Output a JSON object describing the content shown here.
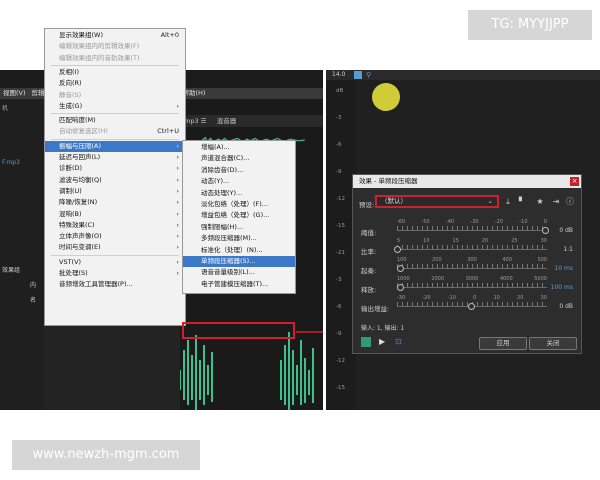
{
  "watermarks": {
    "top": "TG: MYYJJPP",
    "bottom": "www.newzh-mgm.com"
  },
  "menubar": [
    "视图(V)",
    "剪辑(C)",
    "效果(S)",
    "收藏夹(R)",
    "视图(V)",
    "窗口(W)",
    "帮助(H)"
  ],
  "menubar_active_index": 2,
  "left_fragments": {
    "left_top_label": "机",
    "file_label": "F.mp3",
    "effects_label": "效果组",
    "inner_label": "内",
    "default_label": "名"
  },
  "editor_tabs": [
    "mp3 ☰",
    "混音器"
  ],
  "effects_menu": [
    {
      "label": "显示效果组(W)",
      "accel": "Alt+0",
      "disabled": false
    },
    {
      "label": "编辑效果组内的剪辑效果(F)",
      "accel": "",
      "disabled": true
    },
    {
      "label": "编辑效果组内的音轨效果(T)",
      "accel": "",
      "disabled": true
    },
    {
      "label": "反相(I)",
      "accel": "",
      "disabled": false
    },
    {
      "label": "反向(R)",
      "accel": "",
      "disabled": false
    },
    {
      "label": "静音(S)",
      "accel": "",
      "disabled": true
    },
    {
      "label": "生成(G)",
      "accel": "›",
      "disabled": false
    },
    {
      "label": "匹配响度(M)",
      "accel": "",
      "disabled": false
    },
    {
      "label": "自动修复选区(H)",
      "accel": "Ctrl+U",
      "disabled": true
    },
    {
      "label": "振幅与压限(A)",
      "accel": "›",
      "disabled": false,
      "highlight": true
    },
    {
      "label": "延迟与回声(L)",
      "accel": "›",
      "disabled": false
    },
    {
      "label": "诊断(D)",
      "accel": "›",
      "disabled": false
    },
    {
      "label": "滤波与均衡(Q)",
      "accel": "›",
      "disabled": false
    },
    {
      "label": "调制(U)",
      "accel": "›",
      "disabled": false
    },
    {
      "label": "降噪/恢复(N)",
      "accel": "›",
      "disabled": false
    },
    {
      "label": "混响(B)",
      "accel": "›",
      "disabled": false
    },
    {
      "label": "特殊效果(C)",
      "accel": "›",
      "disabled": false
    },
    {
      "label": "立体声声像(O)",
      "accel": "›",
      "disabled": false
    },
    {
      "label": "时间与变调(E)",
      "accel": "›",
      "disabled": false
    },
    {
      "label": "VST(V)",
      "accel": "›",
      "disabled": false
    },
    {
      "label": "批处理(S)",
      "accel": "›",
      "disabled": false
    },
    {
      "label": "音频增效工具管理器(P)...",
      "accel": "",
      "disabled": false
    }
  ],
  "submenu": [
    {
      "label": "增幅(A)..."
    },
    {
      "label": "声道混合器(C)..."
    },
    {
      "label": "消除齿音(D)..."
    },
    {
      "label": "动态(Y)..."
    },
    {
      "label": "动态处理(Y)..."
    },
    {
      "label": "淡化包络（处理）(F)..."
    },
    {
      "label": "增益包络（处理）(G)..."
    },
    {
      "label": "强制限幅(H)..."
    },
    {
      "label": "多频段压缩器(M)..."
    },
    {
      "label": "标准化（处理）(N)..."
    },
    {
      "label": "单频段压缩器(S)...",
      "highlight": true
    },
    {
      "label": "语音音量级别(L)..."
    },
    {
      "label": "电子管建模压缩器(T)..."
    }
  ],
  "right_panel": {
    "zoom": "14.0",
    "db_label": "dB",
    "db_scale": [
      "dB",
      "-3",
      "-6",
      "-9",
      "-12",
      "-15",
      "-21",
      "-3",
      "-6",
      "-9",
      "-12",
      "-15"
    ]
  },
  "dialog": {
    "title": "效果 - 单频段压缩器",
    "preset_label": "预设:",
    "preset_value": "（默认）",
    "icons": [
      "download-icon",
      "delete-icon",
      "favorite-icon",
      "apply-icon",
      "info-icon"
    ],
    "rows": [
      {
        "label": "阈值:",
        "ticks": [
          "-60",
          "-50",
          "-40",
          "-30",
          "-20",
          "-10",
          "0"
        ],
        "value": "0 dB",
        "value_color": "#cfcfcf",
        "level": 1.0
      },
      {
        "label": "比率:",
        "ticks": [
          "5",
          "10",
          "15",
          "20",
          "25",
          "30"
        ],
        "value": "1:1",
        "value_color": "#cfcfcf",
        "level": 0.0
      },
      {
        "label": "起奏:",
        "ticks": [
          "100",
          "200",
          "300",
          "400",
          "500"
        ],
        "value": "10 ms",
        "value_color": "#5b9bd5",
        "level": 0.02
      },
      {
        "label": "释放:",
        "ticks": [
          "1000",
          "2000",
          "3000",
          "4000",
          "5000"
        ],
        "value": "100 ms",
        "value_color": "#5b9bd5",
        "level": 0.02
      },
      {
        "label": "输出增益:",
        "ticks": [
          "-30",
          "-20",
          "-10",
          "0",
          "10",
          "20",
          "30"
        ],
        "value": "0 dB",
        "value_color": "#cfcfcf",
        "level": 0.5
      }
    ],
    "io": "输入: 1, 输出: 1",
    "apply_label": "应用",
    "close_label": "关闭"
  }
}
